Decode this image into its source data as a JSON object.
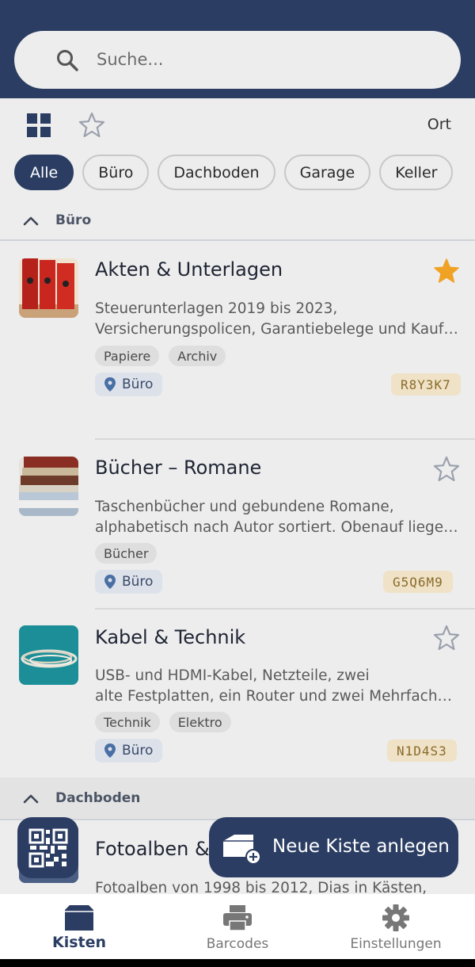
{
  "search": {
    "placeholder": "Suche..."
  },
  "toolbar": {
    "sort_label": "Ort"
  },
  "filters": [
    {
      "label": "Alle",
      "active": true
    },
    {
      "label": "Büro"
    },
    {
      "label": "Dachboden"
    },
    {
      "label": "Garage"
    },
    {
      "label": "Keller"
    }
  ],
  "sections": [
    {
      "title": "Büro"
    },
    {
      "title": "Dachboden"
    }
  ],
  "boxes": [
    {
      "title": "Akten & Unterlagen",
      "desc_line1": "Steuerunterlagen 2019 bis 2023,",
      "desc_line2": "Versicherungspolicen, Garantiebelege und Kaufv...",
      "tags": [
        "Papiere",
        "Archiv"
      ],
      "location": "Büro",
      "code": "R8Y3K7",
      "favorite": true
    },
    {
      "title": "Bücher – Romane",
      "desc_line1": "Taschenbücher und gebundene Romane,",
      "desc_line2": "alphabetisch nach Autor sortiert. Obenauf liegen ...",
      "tags": [
        "Bücher"
      ],
      "location": "Büro",
      "code": "G5Q6M9",
      "favorite": false
    },
    {
      "title": "Kabel & Technik",
      "desc_line1": "USB- und HDMI-Kabel, Netzteile, zwei",
      "desc_line2": "alte Festplatten, ein Router und zwei Mehrfachst...",
      "tags": [
        "Technik",
        "Elektro"
      ],
      "location": "Büro",
      "code": "N1D4S3",
      "favorite": false
    },
    {
      "title": "Fotoalben &",
      "desc_line1": "Fotoalben von 1998 bis 2012, Dias in Kästen,"
    }
  ],
  "fab": {
    "new_box_label": "Neue Kiste anlegen"
  },
  "nav": [
    {
      "label": "Kisten",
      "active": true
    },
    {
      "label": "Barcodes"
    },
    {
      "label": "Einstellungen"
    }
  ],
  "colors": {
    "primary": "#2b3d63",
    "favorite": "#f0a224",
    "code_bg": "#efe2c6",
    "location_bg": "#dde2ea"
  }
}
